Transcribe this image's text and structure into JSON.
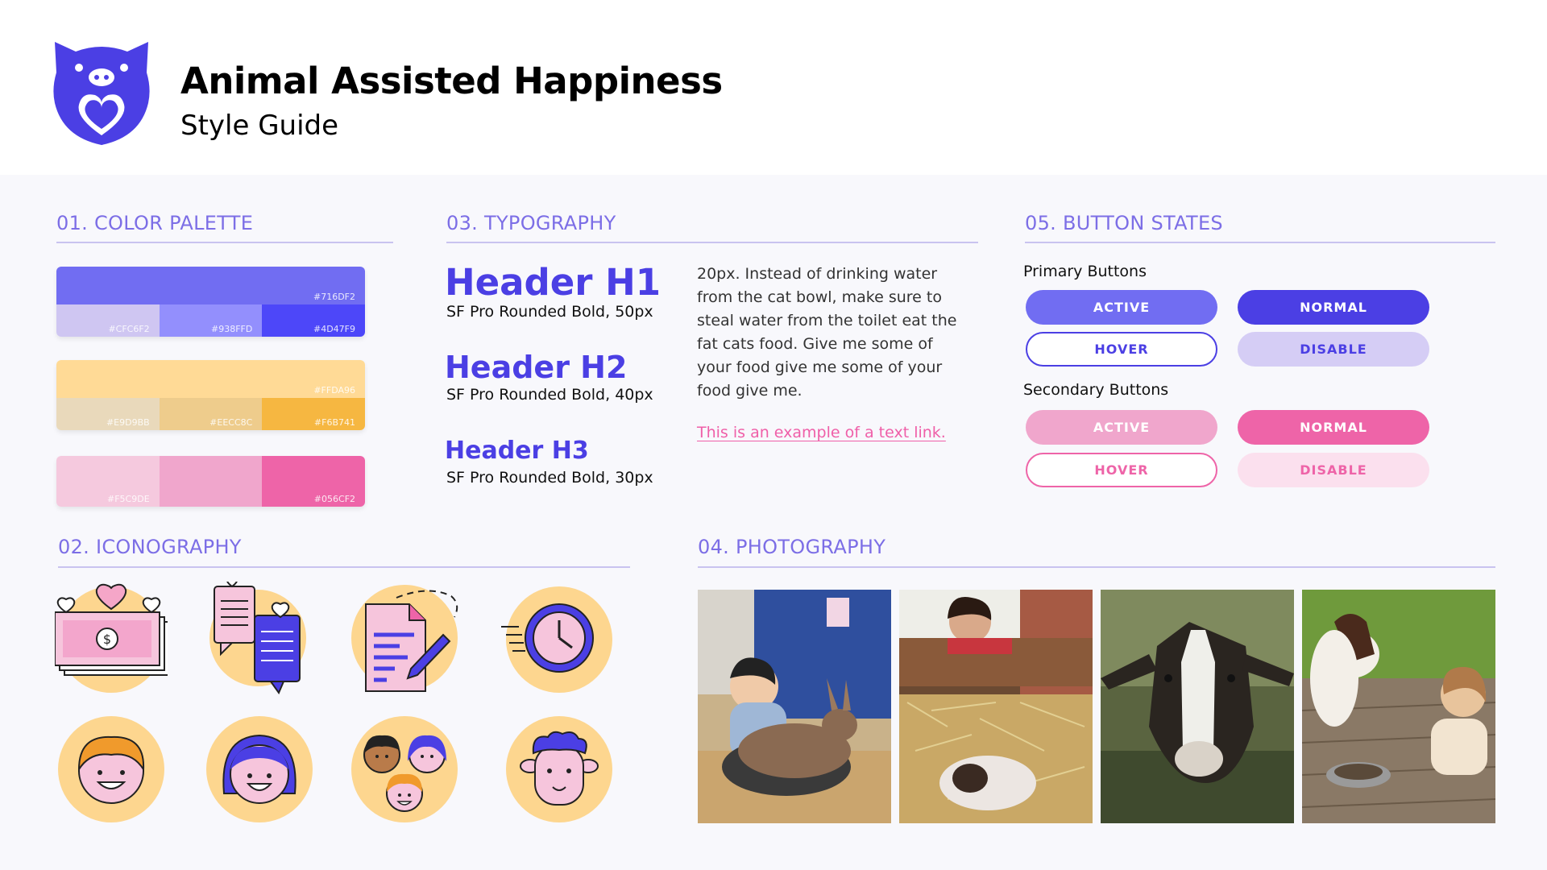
{
  "brand": {
    "title": "Animal Assisted Happiness",
    "subtitle": "Style Guide",
    "logo_icon": "pig-heart-logo-icon"
  },
  "sections": {
    "color_palette": "01. COLOR PALETTE",
    "iconography": "02. ICONOGRAPHY",
    "typography": "03. TYPOGRAPHY",
    "photography": "04. PHOTOGRAPHY",
    "button_states": "05. BUTTON STATES"
  },
  "palette": {
    "purple": {
      "main": "#716DF2",
      "shades": [
        "#CFC6F2",
        "#938FFD",
        "#4D47F9"
      ]
    },
    "yellow": {
      "main": "#FFDA96",
      "shades": [
        "#E9D9BB",
        "#EECC8C",
        "#F6B741"
      ]
    },
    "pink": {
      "shades": [
        "#F5C9DE",
        "",
        "#056CF2"
      ]
    }
  },
  "typography": {
    "h1": {
      "label": "Header H1",
      "desc": "SF Pro Rounded Bold, 50px"
    },
    "h2": {
      "label": "Header H2",
      "desc": "SF Pro Rounded Bold, 40px"
    },
    "h3": {
      "label": "Header H3",
      "desc": "SF Pro Rounded Bold, 30px"
    },
    "body": "20px. Instead of drinking water from the cat bowl, make sure to steal water from the toilet eat the fat cats food. Give me some of your food give me some of your food give me.",
    "link": "This is an example of a text link."
  },
  "buttons": {
    "primary_label": "Primary Buttons",
    "secondary_label": "Secondary Buttons",
    "primary": {
      "active": "ACTIVE",
      "normal": "NORMAL",
      "hover": "HOVER",
      "disable": "DISABLE"
    },
    "secondary": {
      "active": "ACTIVE",
      "normal": "NORMAL",
      "hover": "HOVER",
      "disable": "DISABLE"
    }
  },
  "icons": [
    "money-hearts-icon",
    "chat-bubbles-icon",
    "document-pen-icon",
    "fast-clock-icon",
    "boy-face-icon",
    "girl-face-icon",
    "group-faces-icon",
    "sheep-face-icon"
  ],
  "photos": [
    "boy-with-rabbit-photo",
    "girl-with-guinea-pig-photo",
    "goat-photo",
    "dog-and-child-photo"
  ],
  "colors": {
    "accent_purple": "#4b3fe4",
    "section_title": "#7c6ee6",
    "pink": "#ef5fa8",
    "icon_bg": "#fdd68f"
  }
}
